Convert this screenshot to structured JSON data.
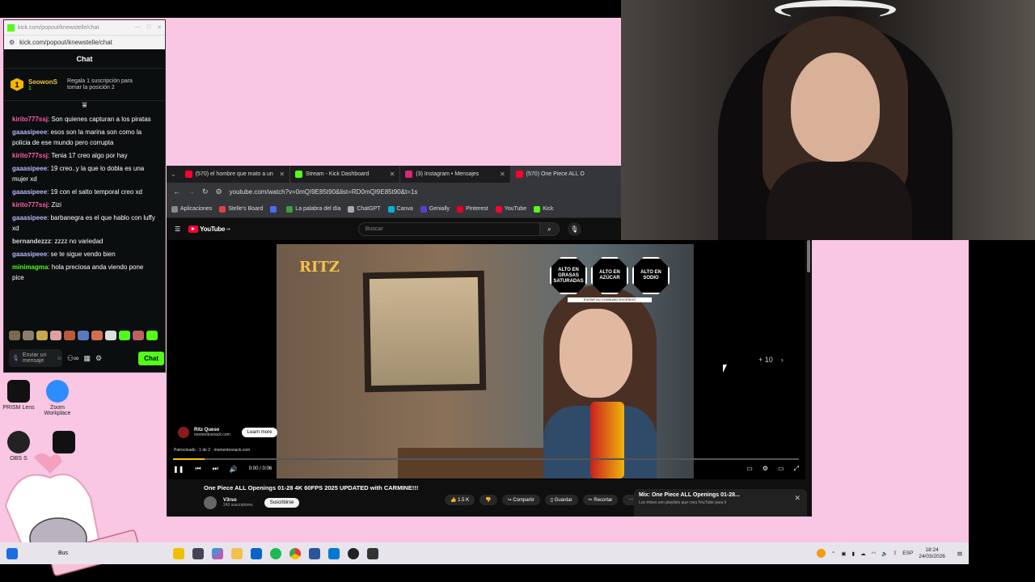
{
  "chat_window": {
    "title_url": "kick.com/popout/knewstelle/chat",
    "url": "kick.com/popout/knewstelle/chat",
    "header": "Chat",
    "pinned": {
      "rank": "1",
      "user": "SeowonS",
      "sub": "1",
      "gift_text": "Regala 1 suscripción para tomar la posición 2"
    },
    "messages": [
      {
        "user": "kirito777ssj",
        "color": "#ff5fa8",
        "text": "Son quienes capturan a los piratas"
      },
      {
        "user": "gaaasipeee",
        "color": "#b8b8ff",
        "text": "esos son la marina son como la policia de ese mundo pero corrupta"
      },
      {
        "user": "kirito777ssj",
        "color": "#ff5fa8",
        "text": "Tenia 17 creo algo por hay"
      },
      {
        "user": "gaaasipeee",
        "color": "#b8b8ff",
        "text": "19 creo..y la que lo dobla es una mujer xd"
      },
      {
        "user": "gaaasipeee",
        "color": "#b8b8ff",
        "text": "19 con el salto temporal creo xd"
      },
      {
        "user": "kirito777ssj",
        "color": "#ff5fa8",
        "text": "Zizi"
      },
      {
        "user": "gaaasipeee",
        "color": "#b8b8ff",
        "text": "barbanegra es el que hablo con luffy xd"
      },
      {
        "user": "bernandezzz",
        "color": "#d8d8d8",
        "text": "zzzz no variedad"
      },
      {
        "user": "gaaasipeee",
        "color": "#b8b8ff",
        "text": "se te sigue vendo bien"
      },
      {
        "user": "minimagma",
        "color": "#53fc18",
        "text": "hola preciosa anda viendo pone pice"
      }
    ],
    "input_placeholder": "Enviar un mensaje",
    "chat_button": "Chat"
  },
  "desktop_icons": [
    {
      "label": "PRISM Lens"
    },
    {
      "label": "Zoom Workplace"
    },
    {
      "label": "OBS S"
    }
  ],
  "browser": {
    "tabs": [
      {
        "label": "(570) el hombre que mato a un",
        "color": "#ff0033"
      },
      {
        "label": "Stream - Kick Dashboard",
        "color": "#53fc18"
      },
      {
        "label": "(3) Instagram • Mensajes",
        "color": "#d62976"
      },
      {
        "label": "(570) One Piece ALL O",
        "color": "#ff0033"
      }
    ],
    "url": "youtube.com/watch?v=0mQI9E85t90&list=RD0mQI9E85t90&t=1s",
    "bookmarks": [
      {
        "label": "Aplicaciones",
        "color": "#888888"
      },
      {
        "label": "Stelle's Board",
        "color": "#e04040"
      },
      {
        "label": "",
        "color": "#4a6cf0"
      },
      {
        "label": "La palabra del día",
        "color": "#3aa040"
      },
      {
        "label": "ChatGPT",
        "color": "#aaaaaa"
      },
      {
        "label": "Canva",
        "color": "#00b4d8"
      },
      {
        "label": "Genially",
        "color": "#5a3dd6"
      },
      {
        "label": "Pinterest",
        "color": "#e60023"
      },
      {
        "label": "YouTube",
        "color": "#ff0033"
      },
      {
        "label": "Kick",
        "color": "#53fc18"
      }
    ]
  },
  "youtube": {
    "logo": "YouTube",
    "logo_country": "PE",
    "search_placeholder": "Buscar",
    "ad": {
      "brand": "RITZ",
      "octagons": [
        "ALTO EN GRASAS SATURADAS",
        "ALTO EN AZÚCAR",
        "ALTO EN SODIO"
      ],
      "warning": "EVITAR SU CONSUMO EXCESIVO",
      "advertiser": "Ritz Queso",
      "advertiser_url": "momentosnack.com",
      "learn_more": "Learn more",
      "sponsored": "Patrocinado · 1 de 2 · momentosnack.com",
      "skip_text": "+ 10",
      "progress": 0.05
    },
    "time": "0:00 / 0:06",
    "video_title": "One Piece ALL Openings 01-28 4K 60FPS 2025 UPDATED with CARMINE!!!",
    "channel": "V3rso",
    "subscribers": "243 suscriptores",
    "subscribe": "Suscribirse",
    "likes": "1.5 K",
    "share": "Compartir",
    "save": "Guardar",
    "clip": "Recortar",
    "mix_title": "Mix: One Piece ALL Openings 01-28...",
    "mix_sub": "Los mixes son playlists que crea YouTube para ti"
  },
  "taskbar": {
    "search": "Bus",
    "language": "ESP",
    "time": "18:24",
    "date": "24/03/2026"
  }
}
